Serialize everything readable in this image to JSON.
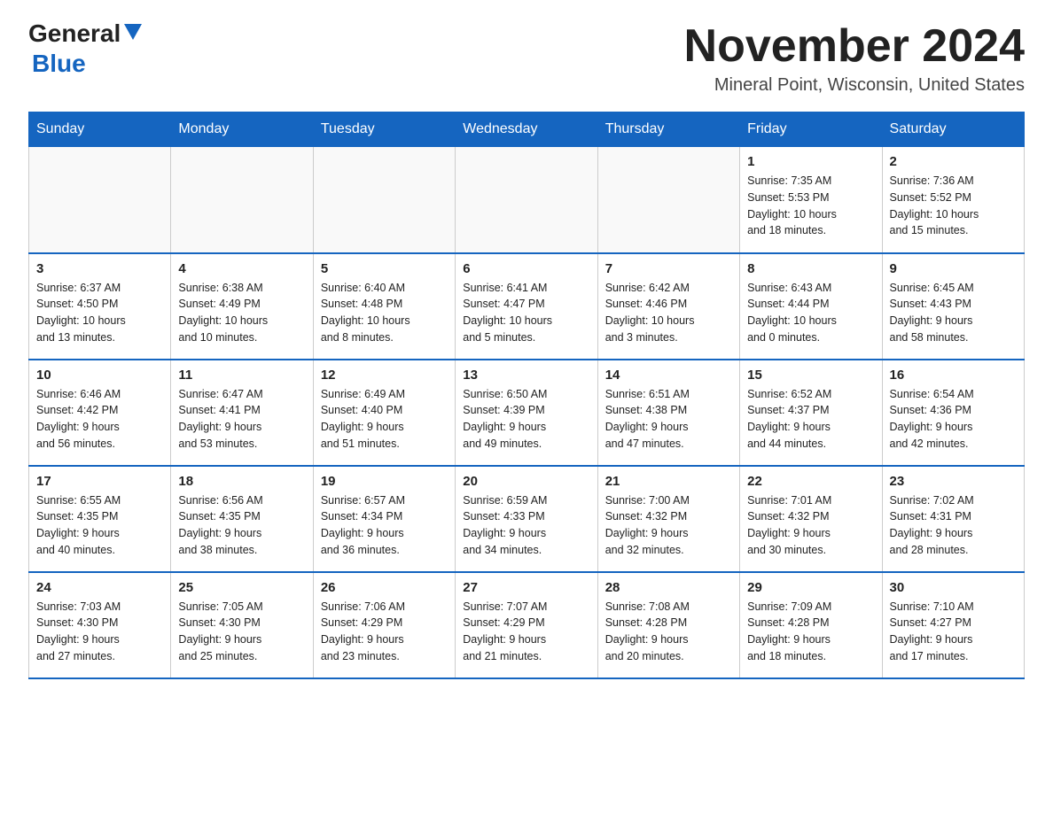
{
  "logo": {
    "general": "General",
    "blue": "Blue"
  },
  "title": "November 2024",
  "location": "Mineral Point, Wisconsin, United States",
  "weekdays": [
    "Sunday",
    "Monday",
    "Tuesday",
    "Wednesday",
    "Thursday",
    "Friday",
    "Saturday"
  ],
  "weeks": [
    [
      {
        "day": "",
        "info": ""
      },
      {
        "day": "",
        "info": ""
      },
      {
        "day": "",
        "info": ""
      },
      {
        "day": "",
        "info": ""
      },
      {
        "day": "",
        "info": ""
      },
      {
        "day": "1",
        "info": "Sunrise: 7:35 AM\nSunset: 5:53 PM\nDaylight: 10 hours\nand 18 minutes."
      },
      {
        "day": "2",
        "info": "Sunrise: 7:36 AM\nSunset: 5:52 PM\nDaylight: 10 hours\nand 15 minutes."
      }
    ],
    [
      {
        "day": "3",
        "info": "Sunrise: 6:37 AM\nSunset: 4:50 PM\nDaylight: 10 hours\nand 13 minutes."
      },
      {
        "day": "4",
        "info": "Sunrise: 6:38 AM\nSunset: 4:49 PM\nDaylight: 10 hours\nand 10 minutes."
      },
      {
        "day": "5",
        "info": "Sunrise: 6:40 AM\nSunset: 4:48 PM\nDaylight: 10 hours\nand 8 minutes."
      },
      {
        "day": "6",
        "info": "Sunrise: 6:41 AM\nSunset: 4:47 PM\nDaylight: 10 hours\nand 5 minutes."
      },
      {
        "day": "7",
        "info": "Sunrise: 6:42 AM\nSunset: 4:46 PM\nDaylight: 10 hours\nand 3 minutes."
      },
      {
        "day": "8",
        "info": "Sunrise: 6:43 AM\nSunset: 4:44 PM\nDaylight: 10 hours\nand 0 minutes."
      },
      {
        "day": "9",
        "info": "Sunrise: 6:45 AM\nSunset: 4:43 PM\nDaylight: 9 hours\nand 58 minutes."
      }
    ],
    [
      {
        "day": "10",
        "info": "Sunrise: 6:46 AM\nSunset: 4:42 PM\nDaylight: 9 hours\nand 56 minutes."
      },
      {
        "day": "11",
        "info": "Sunrise: 6:47 AM\nSunset: 4:41 PM\nDaylight: 9 hours\nand 53 minutes."
      },
      {
        "day": "12",
        "info": "Sunrise: 6:49 AM\nSunset: 4:40 PM\nDaylight: 9 hours\nand 51 minutes."
      },
      {
        "day": "13",
        "info": "Sunrise: 6:50 AM\nSunset: 4:39 PM\nDaylight: 9 hours\nand 49 minutes."
      },
      {
        "day": "14",
        "info": "Sunrise: 6:51 AM\nSunset: 4:38 PM\nDaylight: 9 hours\nand 47 minutes."
      },
      {
        "day": "15",
        "info": "Sunrise: 6:52 AM\nSunset: 4:37 PM\nDaylight: 9 hours\nand 44 minutes."
      },
      {
        "day": "16",
        "info": "Sunrise: 6:54 AM\nSunset: 4:36 PM\nDaylight: 9 hours\nand 42 minutes."
      }
    ],
    [
      {
        "day": "17",
        "info": "Sunrise: 6:55 AM\nSunset: 4:35 PM\nDaylight: 9 hours\nand 40 minutes."
      },
      {
        "day": "18",
        "info": "Sunrise: 6:56 AM\nSunset: 4:35 PM\nDaylight: 9 hours\nand 38 minutes."
      },
      {
        "day": "19",
        "info": "Sunrise: 6:57 AM\nSunset: 4:34 PM\nDaylight: 9 hours\nand 36 minutes."
      },
      {
        "day": "20",
        "info": "Sunrise: 6:59 AM\nSunset: 4:33 PM\nDaylight: 9 hours\nand 34 minutes."
      },
      {
        "day": "21",
        "info": "Sunrise: 7:00 AM\nSunset: 4:32 PM\nDaylight: 9 hours\nand 32 minutes."
      },
      {
        "day": "22",
        "info": "Sunrise: 7:01 AM\nSunset: 4:32 PM\nDaylight: 9 hours\nand 30 minutes."
      },
      {
        "day": "23",
        "info": "Sunrise: 7:02 AM\nSunset: 4:31 PM\nDaylight: 9 hours\nand 28 minutes."
      }
    ],
    [
      {
        "day": "24",
        "info": "Sunrise: 7:03 AM\nSunset: 4:30 PM\nDaylight: 9 hours\nand 27 minutes."
      },
      {
        "day": "25",
        "info": "Sunrise: 7:05 AM\nSunset: 4:30 PM\nDaylight: 9 hours\nand 25 minutes."
      },
      {
        "day": "26",
        "info": "Sunrise: 7:06 AM\nSunset: 4:29 PM\nDaylight: 9 hours\nand 23 minutes."
      },
      {
        "day": "27",
        "info": "Sunrise: 7:07 AM\nSunset: 4:29 PM\nDaylight: 9 hours\nand 21 minutes."
      },
      {
        "day": "28",
        "info": "Sunrise: 7:08 AM\nSunset: 4:28 PM\nDaylight: 9 hours\nand 20 minutes."
      },
      {
        "day": "29",
        "info": "Sunrise: 7:09 AM\nSunset: 4:28 PM\nDaylight: 9 hours\nand 18 minutes."
      },
      {
        "day": "30",
        "info": "Sunrise: 7:10 AM\nSunset: 4:27 PM\nDaylight: 9 hours\nand 17 minutes."
      }
    ]
  ]
}
